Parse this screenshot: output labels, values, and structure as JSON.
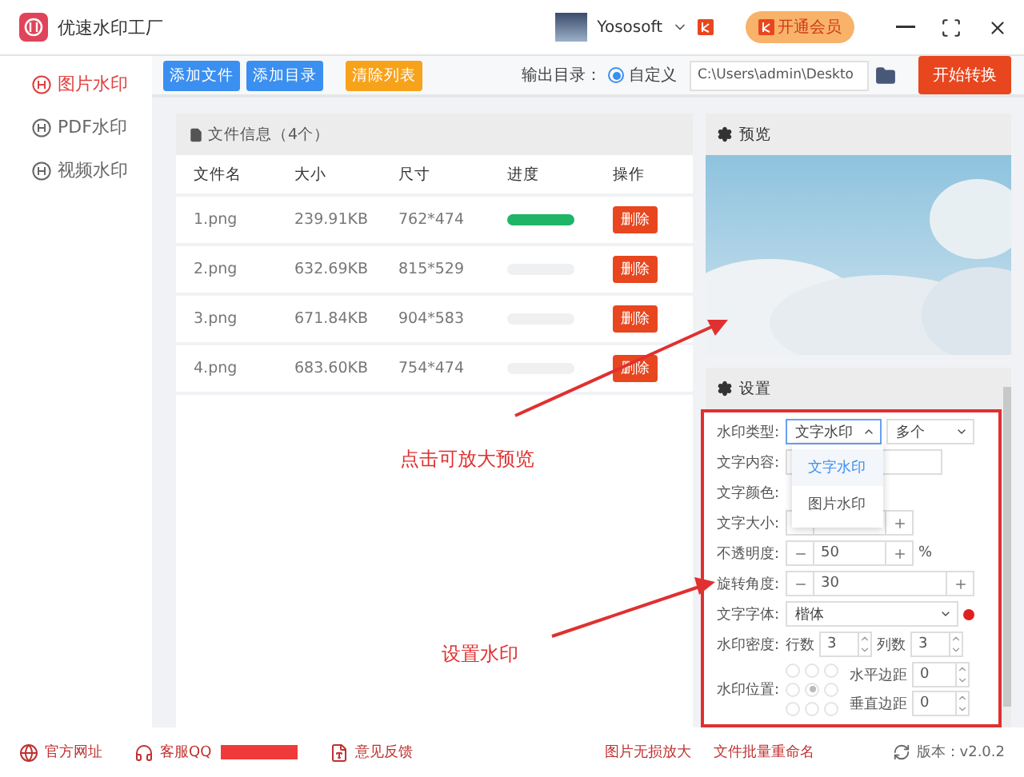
{
  "app": {
    "title": "优速水印工厂"
  },
  "account": {
    "user": "Yososoft",
    "vip_label": "开通会员"
  },
  "toolbar": {
    "buttons": [
      {
        "label": "添加文件",
        "kind": "primary"
      },
      {
        "label": "添加目录",
        "kind": "primary"
      },
      {
        "label": "清除列表",
        "kind": "warning"
      }
    ],
    "output_label": "输出目录：",
    "output_option": {
      "label": "自定义",
      "selected": true
    },
    "output_path": "C:\\Users\\admin\\Deskto",
    "start_label": "开始转换"
  },
  "sidebar": {
    "items": [
      {
        "label": "图片水印",
        "selected": true
      },
      {
        "label": "PDF水印",
        "selected": false
      },
      {
        "label": "视频水印",
        "selected": false
      }
    ]
  },
  "files": {
    "title": "文件信息（4个）",
    "columns": [
      "文件名",
      "大小",
      "尺寸",
      "进度",
      "操作"
    ],
    "rows": [
      {
        "name": "1.png",
        "size": "239.91KB",
        "dimensions": "762*474",
        "level": 1,
        "action": "删除"
      },
      {
        "name": "2.png",
        "size": "632.69KB",
        "dimensions": "815*529",
        "level": 0,
        "action": "删除"
      },
      {
        "name": "3.png",
        "size": "671.84KB",
        "dimensions": "904*583",
        "level": 0,
        "action": "删除"
      },
      {
        "name": "4.png",
        "size": "683.60KB",
        "dimensions": "754*474",
        "level": 0,
        "action": "删除"
      }
    ]
  },
  "preview": {
    "title": "预览"
  },
  "settings": {
    "title": "设置",
    "type_label": "水印类型:",
    "type_value": "文字水印",
    "type_menu": [
      {
        "label": "文字水印",
        "selected": true
      },
      {
        "label": "图片水印",
        "selected": false
      }
    ],
    "count_value": "多个",
    "content_label": "文字内容:",
    "color_label": "文字颜色:",
    "size_label": "文字大小:",
    "opacity_label": "不透明度:",
    "opacity_value": "50",
    "opacity_unit": "%",
    "rotation_label": "旋转角度:",
    "rotation_value": "30",
    "font_label": "文字字体:",
    "font_value": "楷体",
    "density_label": "水印密度:",
    "rows_label": "行数",
    "rows_value": "3",
    "cols_label": "列数",
    "cols_value": "3",
    "position_label": "水印位置:",
    "positions": [
      {
        "selected": false
      },
      {
        "selected": false
      },
      {
        "selected": false
      },
      {
        "selected": false
      },
      {
        "selected": true
      },
      {
        "selected": false
      },
      {
        "selected": false
      },
      {
        "selected": false
      },
      {
        "selected": false
      }
    ],
    "h_margin_label": "水平边距",
    "h_margin_value": "0",
    "v_margin_label": "垂直边距",
    "v_margin_value": "0"
  },
  "annotations": [
    {
      "text": "点击可放大预览"
    },
    {
      "text": "设置水印"
    }
  ],
  "footer": {
    "links": [
      {
        "label": "官方网址",
        "kind": "web"
      },
      {
        "label": "客服QQ",
        "kind": "qq"
      },
      {
        "label": "意见反馈",
        "kind": "pdf"
      },
      {
        "label": "图片无损放大",
        "kind": "plain"
      },
      {
        "label": "文件批量重命名",
        "kind": "plain"
      }
    ],
    "version": "版本：v2.0.2"
  }
}
